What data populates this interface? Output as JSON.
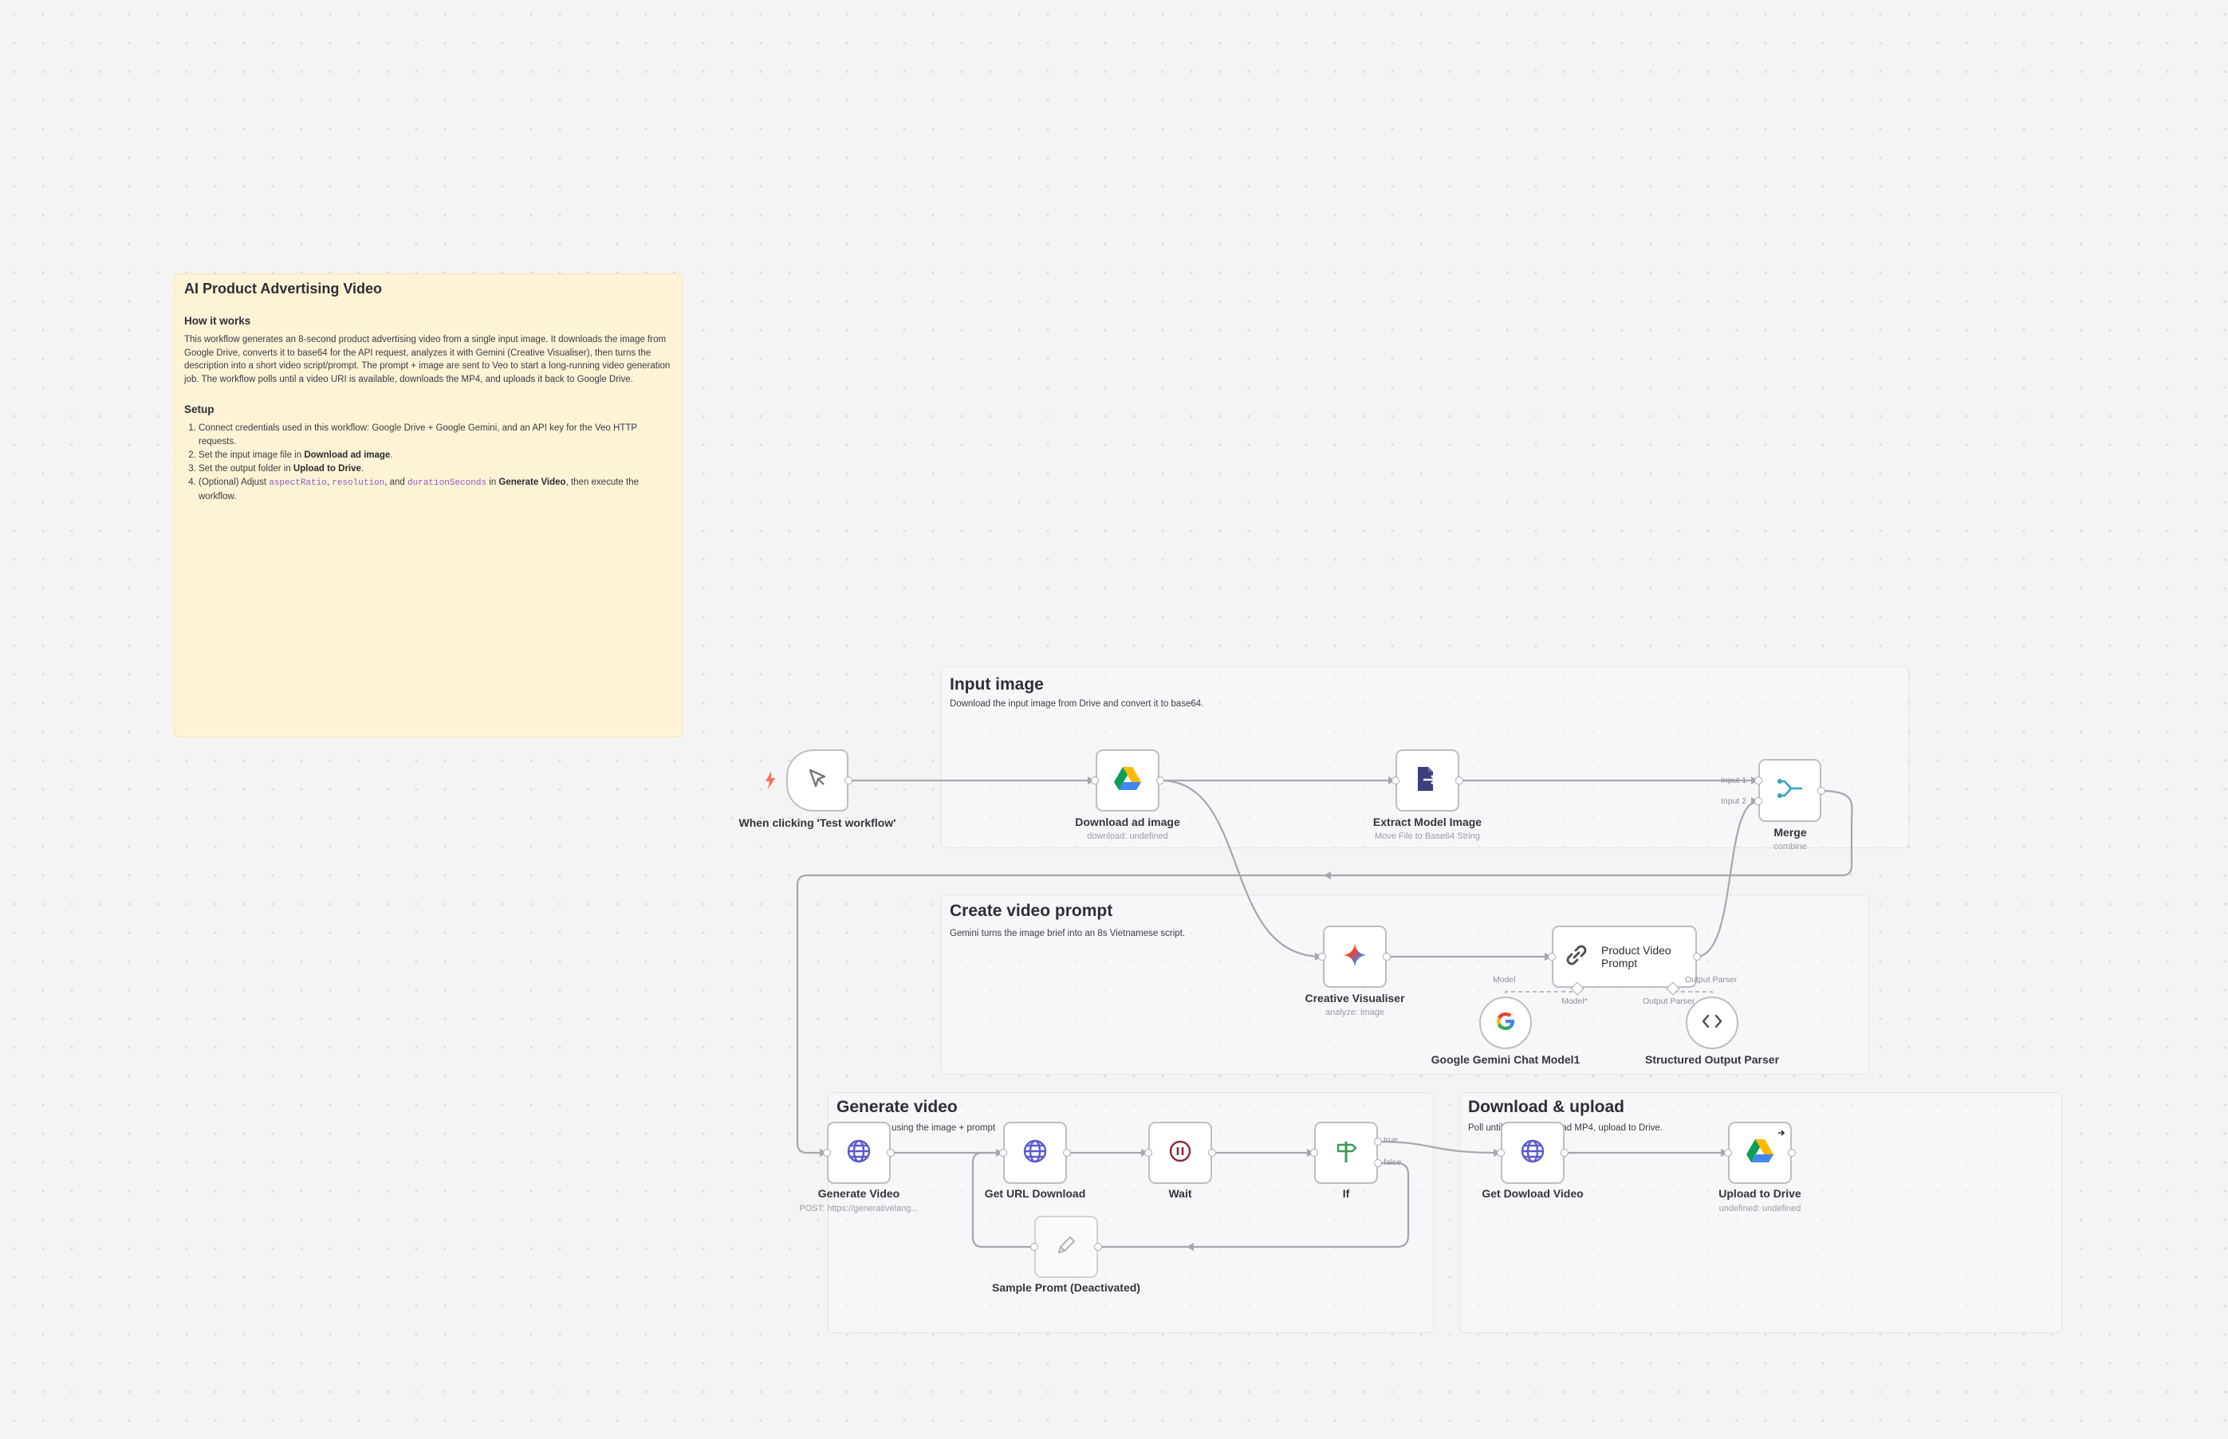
{
  "note": {
    "title": "AI Product Advertising Video",
    "how_heading": "How it works",
    "how_text": "This workflow generates an 8-second product advertising video from a single input image. It downloads the image from Google Drive, converts it to base64 for the API request, analyzes it with Gemini (Creative Visualiser), then turns the description into a short video script/prompt. The prompt + image are sent to Veo to start a long-running video generation job. The workflow polls until a video URI is available, downloads the MP4, and uploads it back to Google Drive.",
    "setup_heading": "Setup",
    "steps": [
      {
        "a": "Connect credentials used in this workflow: Google Drive + Google Gemini, and an API key for the Veo HTTP requests."
      },
      {
        "a": "Set the input image file in ",
        "b": "Download ad image",
        "c": "."
      },
      {
        "a": "Set the output folder in ",
        "b": "Upload to Drive",
        "c": "."
      },
      {
        "a": "(Optional) Adjust ",
        "code1": "aspectRatio",
        "sep1": ", ",
        "code2": "resolution",
        "sep2": ", and ",
        "code3": "durationSeconds",
        "d": " in ",
        "b": "Generate Video",
        "c": ", then execute the workflow."
      }
    ]
  },
  "groups": {
    "input": {
      "title": "Input image",
      "desc": "Download the input image from Drive and convert it to base64."
    },
    "prompt": {
      "title": "Create video prompt",
      "desc": "Gemini turns the image brief into an 8s Vietnamese script."
    },
    "generate": {
      "title": "Generate video",
      "desc": "Start Veo job using the image + prompt"
    },
    "download": {
      "title": "Download & upload",
      "desc": "Poll until ready, download MP4, upload to Drive."
    }
  },
  "nodes": {
    "trigger": {
      "label": "When clicking 'Test workflow'",
      "icon": "cursor-icon"
    },
    "download_ad": {
      "label": "Download ad image",
      "sub": "download: undefined",
      "icon": "google-drive-icon"
    },
    "extract": {
      "label": "Extract Model Image",
      "sub": "Move File to Base64 String",
      "icon": "file-export-icon"
    },
    "merge": {
      "label": "Merge",
      "sub": "combine",
      "input1": "Input 1",
      "input2": "Input 2",
      "icon": "merge-icon"
    },
    "creative": {
      "label": "Creative Visualiser",
      "sub": "analyze: image",
      "icon": "gemini-sparkle-icon"
    },
    "product_prompt": {
      "label": "Product Video Prompt",
      "model_port": "Model",
      "model_req": "Model*",
      "parser_port": "Output Parser",
      "icon": "link-icon"
    },
    "gemini_model": {
      "label": "Google Gemini Chat Model1",
      "icon": "google-g-icon"
    },
    "parser": {
      "label": "Structured Output Parser",
      "icon": "code-brackets-icon"
    },
    "generate_video": {
      "label": "Generate Video",
      "sub": "POST: https://generativelang...",
      "icon": "globe-icon"
    },
    "get_url": {
      "label": "Get URL Download",
      "icon": "globe-icon"
    },
    "wait": {
      "label": "Wait",
      "icon": "pause-icon"
    },
    "if": {
      "label": "If",
      "true_label": "true",
      "false_label": "false",
      "icon": "signpost-icon"
    },
    "sample_prompt": {
      "label": "Sample Promt (Deactivated)",
      "icon": "pencil-icon"
    },
    "get_download": {
      "label": "Get Dowload Video",
      "icon": "globe-icon"
    },
    "upload": {
      "label": "Upload to Drive",
      "sub": "undefined: undefined",
      "icon": "google-drive-icon"
    }
  },
  "colors": {
    "canvas": "#f4f4f5",
    "note_yellow": "#fff3d6",
    "node_border": "#bdbdc4",
    "wire": "#a6a6ae",
    "trigger_bolt": "#ff6d5a",
    "globe": "#5b57d1",
    "wait": "#8e2a3a",
    "if_green": "#3e9b55",
    "extract_navy": "#3b3f7c",
    "merge_teal": "#36a3c4"
  }
}
